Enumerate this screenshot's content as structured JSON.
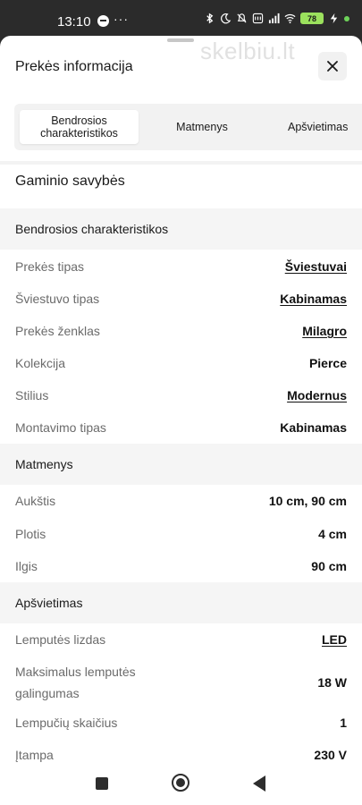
{
  "status_bar": {
    "time": "13:10",
    "dots": "···",
    "battery": "78"
  },
  "watermark": "skelbiu.lt",
  "sheet": {
    "title": "Prekės informacija"
  },
  "tabs": [
    {
      "label": "Bendrosios charakteristikos",
      "active": true
    },
    {
      "label": "Matmenys",
      "active": false
    },
    {
      "label": "Apšvietimas",
      "active": false
    }
  ],
  "product_features_title": "Gaminio savybės",
  "sections": {
    "general": {
      "title": "Bendrosios charakteristikos",
      "rows": [
        {
          "label": "Prekės tipas",
          "value": "Šviestuvai",
          "link": true
        },
        {
          "label": "Šviestuvo tipas",
          "value": "Kabinamas",
          "link": true
        },
        {
          "label": "Prekės ženklas",
          "value": "Milagro",
          "link": true
        },
        {
          "label": "Kolekcija",
          "value": "Pierce",
          "link": false
        },
        {
          "label": "Stilius",
          "value": "Modernus",
          "link": true
        },
        {
          "label": "Montavimo tipas",
          "value": "Kabinamas",
          "link": false
        }
      ]
    },
    "dimensions": {
      "title": "Matmenys",
      "rows": [
        {
          "label": "Aukštis",
          "value": "10 cm, 90 cm",
          "link": false
        },
        {
          "label": "Plotis",
          "value": "4 cm",
          "link": false
        },
        {
          "label": "Ilgis",
          "value": "90 cm",
          "link": false
        }
      ]
    },
    "lighting": {
      "title": "Apšvietimas",
      "rows": [
        {
          "label": "Lemputės lizdas",
          "value": "LED",
          "link": true
        },
        {
          "label": "Maksimalus lemputės galingumas",
          "value": "18 W",
          "link": false
        },
        {
          "label": "Lempučių skaičius",
          "value": "1",
          "link": false
        },
        {
          "label": "Įtampa",
          "value": "230 V",
          "link": false
        }
      ]
    }
  },
  "colors": {
    "sheet_bg": "#ffffff",
    "section_bg": "#f5f5f5",
    "label_text": "#6b6b6b",
    "value_text": "#111111"
  }
}
